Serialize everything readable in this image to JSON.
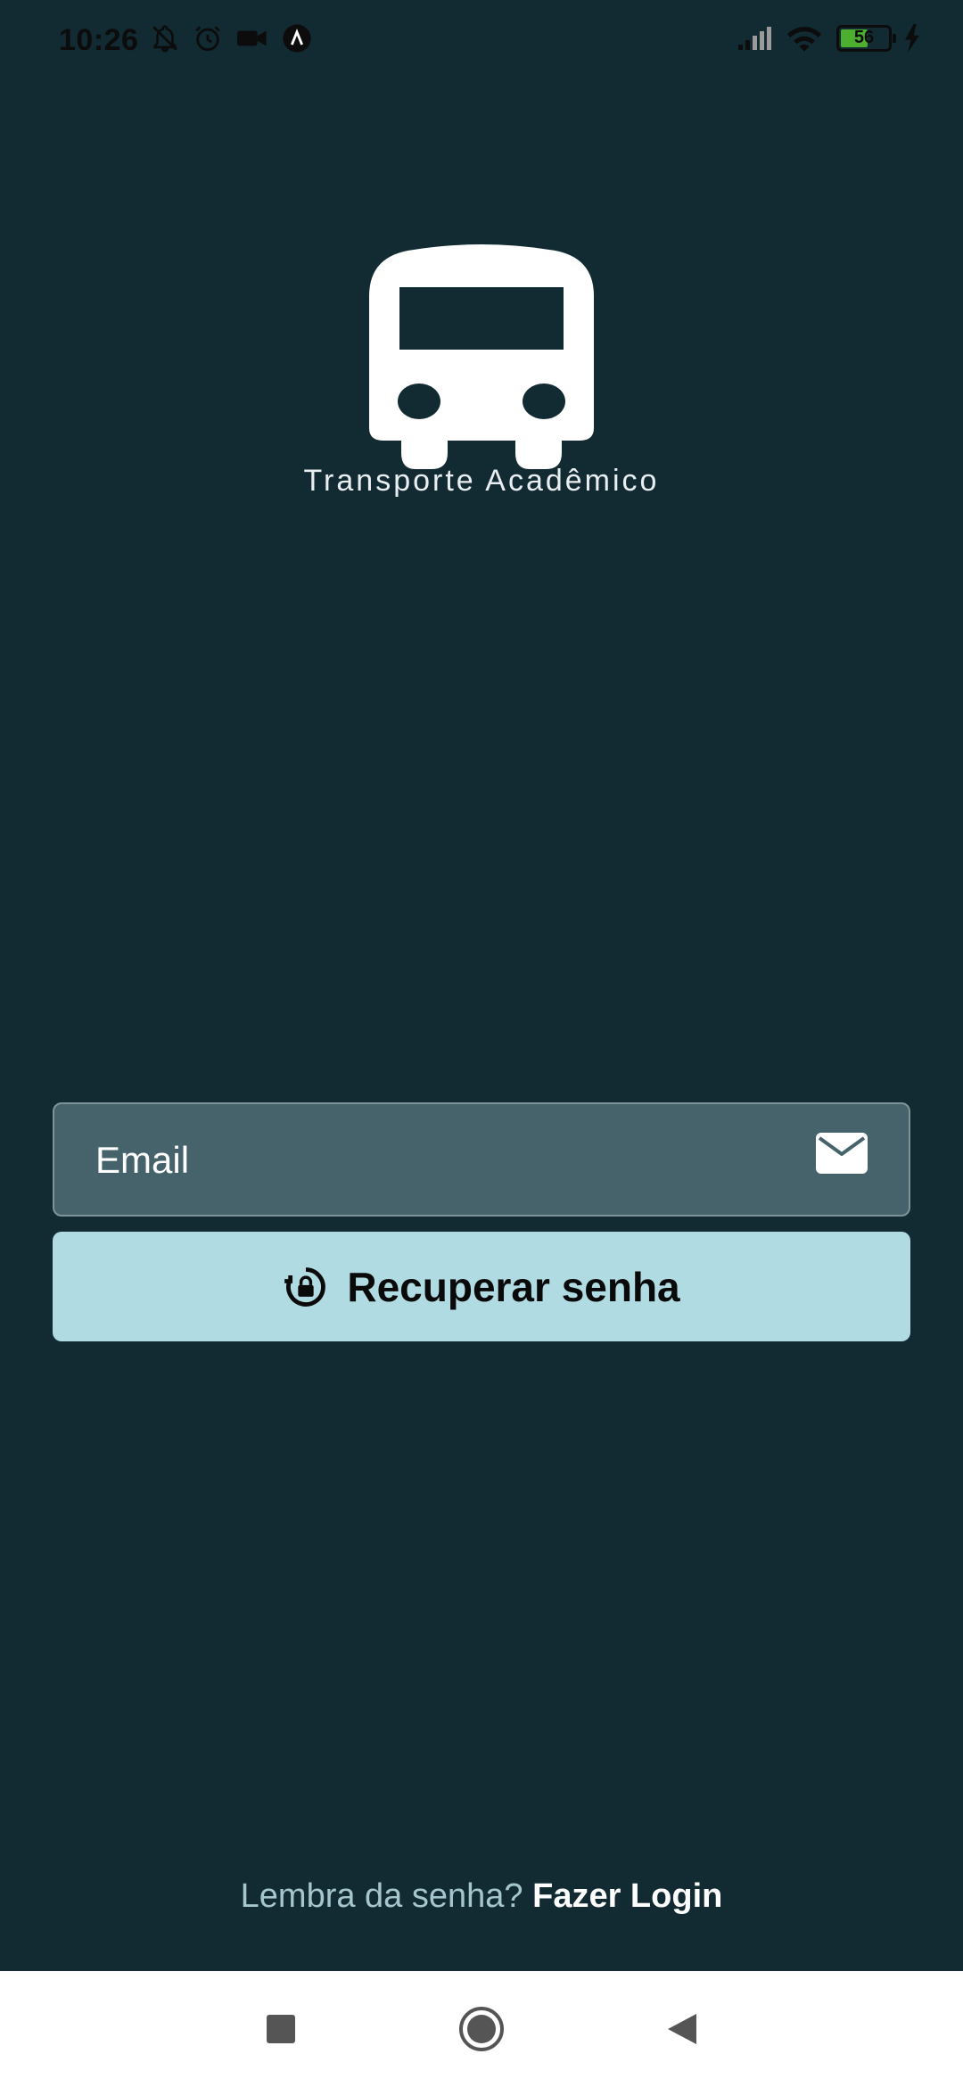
{
  "status_bar": {
    "time": "10:26",
    "battery_level": "56",
    "left_icons": [
      "notifications-off-icon",
      "alarm-icon",
      "video-camera-icon",
      "app-a-icon"
    ],
    "right_icons": [
      "signal-icon",
      "wifi-icon",
      "battery-icon",
      "charging-icon"
    ]
  },
  "app": {
    "logo_icon": "bus-icon",
    "name": "Transporte Acadêmico"
  },
  "form": {
    "email_placeholder": "Email",
    "email_value": "",
    "email_icon": "mail-icon",
    "recover_label": "Recuperar senha",
    "recover_icon": "lock-reset-icon"
  },
  "footer": {
    "prompt": "Lembra da senha?",
    "login_link": "Fazer Login"
  },
  "nav_bar": {
    "buttons": [
      "recents-button",
      "home-button",
      "back-button"
    ]
  },
  "colors": {
    "background": "#122b33",
    "input_background": "#46636b",
    "button_background": "#b1dbe3",
    "footer_prompt": "#a5c6cd"
  }
}
